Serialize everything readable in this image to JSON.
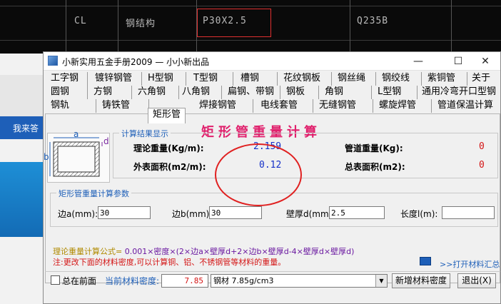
{
  "cad": {
    "cells": [
      "CL",
      "钢结构",
      "P30X2.5",
      "Q235B"
    ]
  },
  "background": {
    "left_button": "我来答"
  },
  "window": {
    "title": "小新实用五金手册2009 — 小小新出品",
    "controls": {
      "minimize": "—",
      "maximize": "☐",
      "close": "✕"
    }
  },
  "tabs": {
    "row1": [
      "工字钢",
      "镀锌钢管",
      "H型钢",
      "T型钢",
      "槽钢",
      "花纹钢板",
      "钢丝绳",
      "钢绞线",
      "紫铜管",
      "关于"
    ],
    "row2": [
      "圆钢",
      "方钢",
      "六角钢",
      "八角钢",
      "扁钢、带钢",
      "钢板",
      "角钢",
      "L型钢",
      "通用冷弯开口型钢"
    ],
    "row3": [
      "钢轨",
      "铸铁管",
      "矩形管",
      "焊接钢管",
      "电线套管",
      "无缝钢管",
      "螺旋焊管",
      "管道保温计算"
    ],
    "active": "矩形管"
  },
  "panel": {
    "heading": "矩形管重量计算",
    "diagram_labels": {
      "a": "a",
      "b": "b",
      "d": "d"
    },
    "results": {
      "group_title": "计算结果显示",
      "theory_weight_label": "理论重量(Kg/m):",
      "theory_weight_value": "2.159",
      "surface_area_label": "外表面积(m2/m):",
      "surface_area_value": "0.12",
      "pipe_weight_label": "管道重量(Kg):",
      "pipe_weight_value": "0",
      "total_area_label": "总表面积(m2):",
      "total_area_value": "0"
    },
    "params": {
      "group_title": "矩形管重量计算参数",
      "side_a_label": "边a(mm):",
      "side_a_value": "30",
      "side_b_label": "边b(mm):",
      "side_b_value": "30",
      "wall_label": "壁厚d(mm)",
      "wall_value": "2.5",
      "length_label": "长度l(m):",
      "length_value": ""
    },
    "formula_label": "理论重量计算公式=",
    "formula": " 0.001×密度×(2×边a×壁厚d+2×边b×壁厚d-4×壁厚d×壁厚d)",
    "note": "注:更改下面的材料密度,可以计算铜、铝、不锈钢管等材料的重量。",
    "summary_link": ">>打开材料汇总"
  },
  "bottom": {
    "always_on_top": "总在前面",
    "density_label": "当前材料密度:",
    "density_value": "7.85",
    "material_select": "钢材 7.85g/cm3",
    "add_density_button": "新增材料密度",
    "exit_button": "退出(X)"
  },
  "colors": {
    "heading": "#e0206c",
    "result_value": "#1530c8",
    "zero_value": "#d41414",
    "group_title": "#1e5fb8",
    "annotation_circle": "#e02020"
  }
}
